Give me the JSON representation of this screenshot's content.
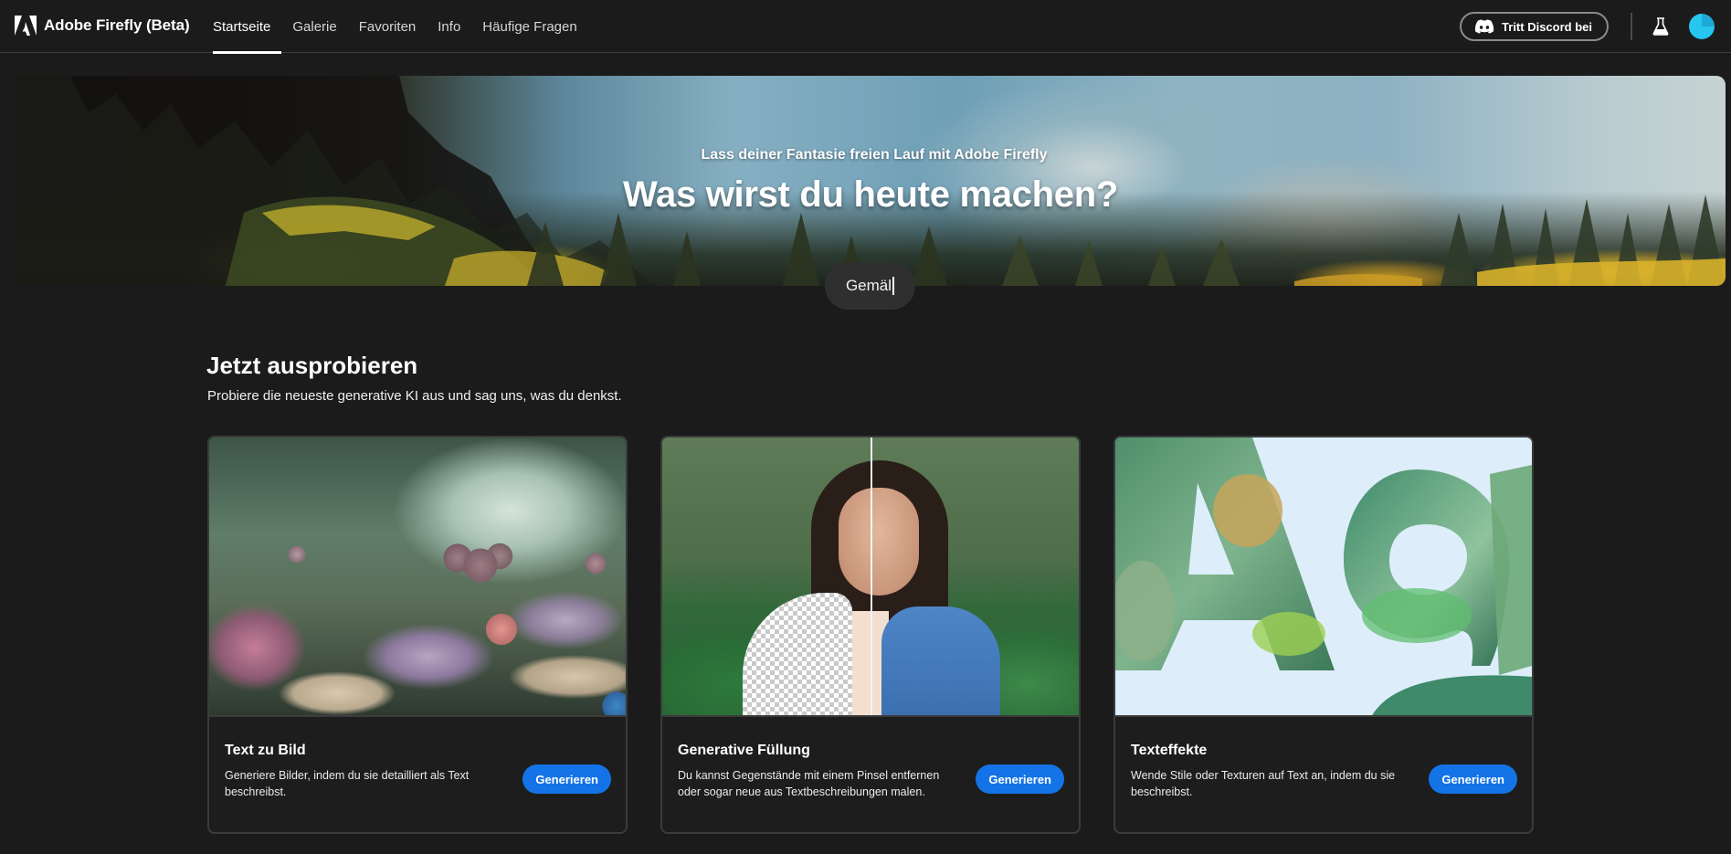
{
  "header": {
    "brand_name": "Adobe Firefly (Beta)",
    "brand_icon": "adobe-logo-icon",
    "nav": [
      {
        "label": "Startseite",
        "active": true
      },
      {
        "label": "Galerie",
        "active": false
      },
      {
        "label": "Favoriten",
        "active": false
      },
      {
        "label": "Info",
        "active": false
      },
      {
        "label": "Häufige Fragen",
        "active": false
      }
    ],
    "discord_button": {
      "label": "Tritt Discord bei",
      "icon": "discord-icon"
    },
    "labs_icon": "flask-icon",
    "avatar_color": "#27c6f0"
  },
  "banner": {
    "subtitle": "Lass deiner Fantasie freien Lauf mit Adobe Firefly",
    "title": "Was wirst du heute machen?",
    "prompt_value": "Gemäl"
  },
  "section": {
    "title": "Jetzt ausprobieren",
    "subtitle": "Probiere die neueste generative KI aus und sag uns, was du denkst."
  },
  "cards": [
    {
      "title": "Text zu Bild",
      "description": "Generiere Bilder, indem du sie detailliert als Text beschreibst.",
      "button_label": "Generieren",
      "image": "fantasy-garden-image"
    },
    {
      "title": "Generative Füllung",
      "description": "Du kannst Gegenstände mit einem Pinsel entfernen oder sogar neue aus Textbeschreibungen malen.",
      "button_label": "Generieren",
      "image": "portrait-before-after-image"
    },
    {
      "title": "Texteffekte",
      "description": "Wende Stile oder Texturen auf Text an, indem du sie beschreibst.",
      "button_label": "Generieren",
      "image": "leaf-letters-image"
    }
  ],
  "colors": {
    "background": "#1b1b1b",
    "accent_button": "#1473e6",
    "card_border": "#3b3b3b",
    "pill_background": "#2f2f2f"
  }
}
